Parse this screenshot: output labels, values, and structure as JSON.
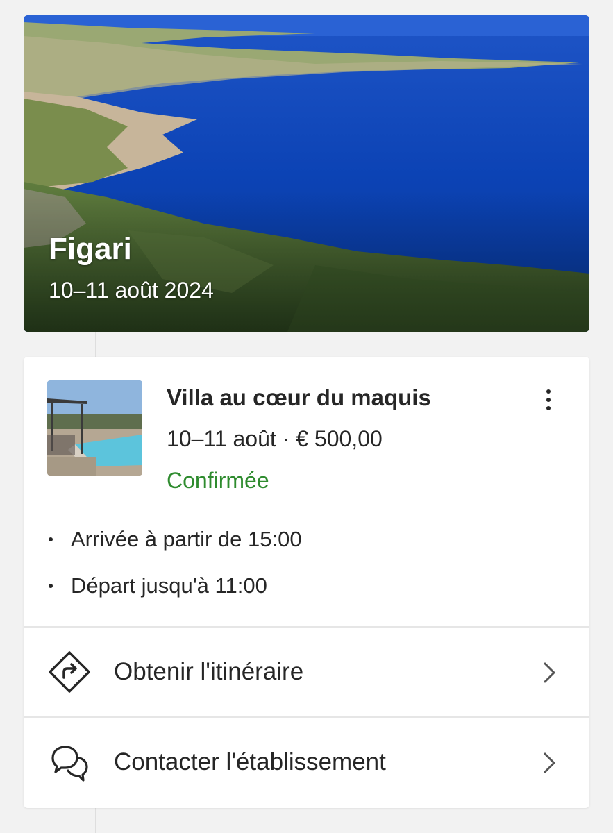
{
  "hero": {
    "title": "Figari",
    "dates": "10–11 août 2024"
  },
  "stay": {
    "name": "Villa au cœur du maquis",
    "meta": "10–11 août · € 500,00",
    "status": "Confirmée",
    "status_color": "#2e8b2e",
    "details": [
      "Arrivée à partir de 15:00",
      "Départ jusqu'à 11:00"
    ]
  },
  "actions": [
    {
      "label": "Obtenir l'itinéraire",
      "icon": "directions-icon"
    },
    {
      "label": "Contacter l'établissement",
      "icon": "chat-bubbles-icon"
    }
  ],
  "colors": {
    "page_background": "#f2f2f2",
    "card_background": "#ffffff",
    "text": "#262626",
    "sea": "#0b46b8"
  }
}
